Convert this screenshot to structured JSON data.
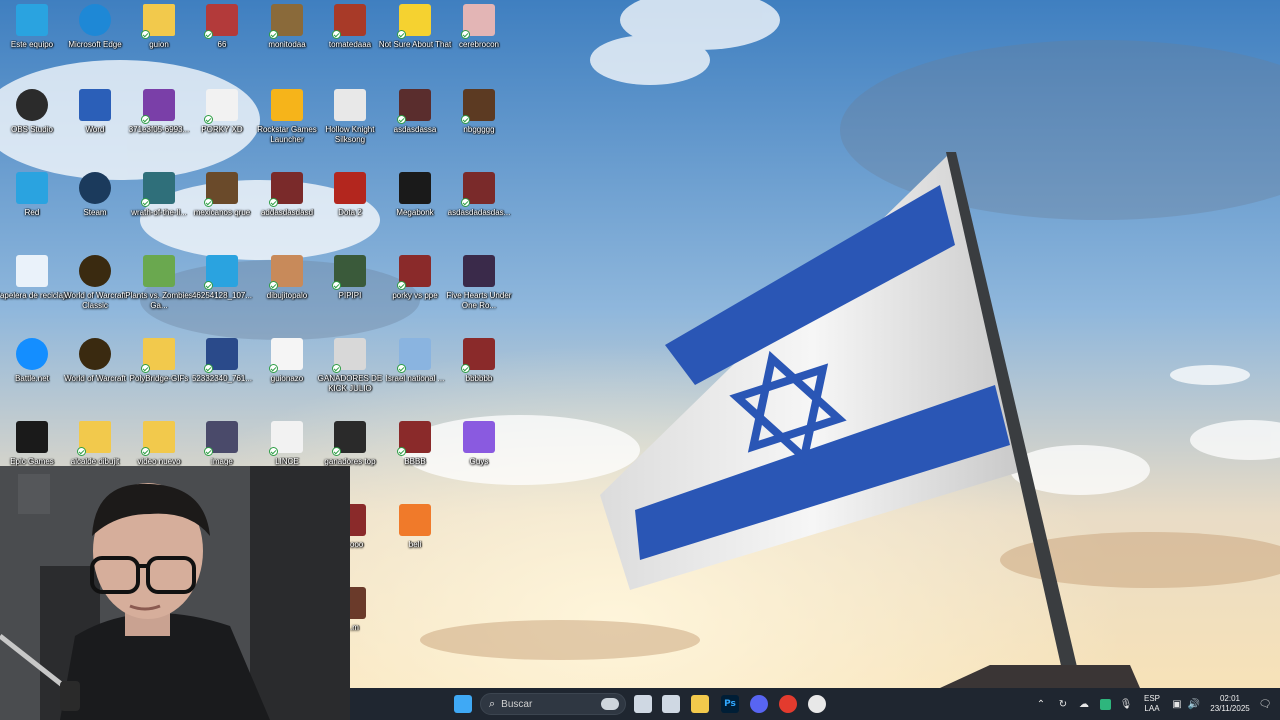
{
  "desktop": {
    "icons": [
      {
        "label": "Este equipo",
        "icon": "pc-icon",
        "color": "#2aa3e0",
        "synced": false
      },
      {
        "label": "Microsoft Edge",
        "icon": "edge-icon",
        "color": "#1e88d6",
        "synced": false
      },
      {
        "label": "guion",
        "icon": "folder-icon",
        "color": "#f2c94c",
        "synced": true
      },
      {
        "label": "66",
        "icon": "image-file-icon",
        "color": "#b33a3a",
        "synced": true
      },
      {
        "label": "monitodaa",
        "icon": "image-file-icon",
        "color": "#8a6a3a",
        "synced": true
      },
      {
        "label": "tomatedaaa",
        "icon": "image-file-icon",
        "color": "#a83a28",
        "synced": true
      },
      {
        "label": "Not Sure About That",
        "icon": "duck-image-icon",
        "color": "#f5d230",
        "synced": true
      },
      {
        "label": "cerebrocon",
        "icon": "image-file-icon",
        "color": "#e3b5b5",
        "synced": true
      },
      {
        "label": "OBS Studio",
        "icon": "obs-icon",
        "color": "#2b2b2b",
        "synced": false
      },
      {
        "label": "Word",
        "icon": "word-icon",
        "color": "#2b5fb8",
        "synced": false
      },
      {
        "label": "371e3f05-6993...",
        "icon": "qr-image-icon",
        "color": "#7a3fa8",
        "synced": true
      },
      {
        "label": "PORKY XD",
        "icon": "video-file-icon",
        "color": "#f2f2f2",
        "synced": true
      },
      {
        "label": "Rockstar Games Launcher",
        "icon": "rockstar-icon",
        "color": "#f6b41a",
        "synced": false
      },
      {
        "label": "Hollow Knight Silksong",
        "icon": "hollow-knight-icon",
        "color": "#e8e8e8",
        "synced": false
      },
      {
        "label": "asdasdassa",
        "icon": "video-thumb-icon",
        "color": "#5a2d2d",
        "synced": true
      },
      {
        "label": "nbggggg",
        "icon": "video-thumb-icon",
        "color": "#5c3a22",
        "synced": true
      },
      {
        "label": "Red",
        "icon": "network-icon",
        "color": "#2aa3e0",
        "synced": false
      },
      {
        "label": "Steam",
        "icon": "steam-icon",
        "color": "#1b3a5c",
        "synced": false
      },
      {
        "label": "wrath-of-the-li...",
        "icon": "image-file-icon",
        "color": "#2f6f7a",
        "synced": true
      },
      {
        "label": "mexicanos qrue",
        "icon": "video-thumb-icon",
        "color": "#6a4a2a",
        "synced": true
      },
      {
        "label": "addasdasdasd",
        "icon": "video-thumb-icon",
        "color": "#7a2a2a",
        "synced": true
      },
      {
        "label": "Dota 2",
        "icon": "dota-icon",
        "color": "#b3261e",
        "synced": false
      },
      {
        "label": "Megabonk",
        "icon": "megabonk-icon",
        "color": "#1a1a1a",
        "synced": false
      },
      {
        "label": "asdasdadasdas...",
        "icon": "video-thumb-icon",
        "color": "#7a2a2a",
        "synced": true
      },
      {
        "label": "Papelera de reciclaje",
        "icon": "recycle-bin-icon",
        "color": "#eaf2fa",
        "synced": false
      },
      {
        "label": "World of Warcraft Classic",
        "icon": "wow-classic-icon",
        "color": "#3a2a10",
        "synced": false
      },
      {
        "label": "Plants vs. Zombies Ga...",
        "icon": "pvz-icon",
        "color": "#6aa84f",
        "synced": false
      },
      {
        "label": "46254128_107...",
        "icon": "image-file-icon",
        "color": "#2aa3e0",
        "synced": true
      },
      {
        "label": "dibujitopalo",
        "icon": "image-file-icon",
        "color": "#c88a5a",
        "synced": true
      },
      {
        "label": "PIPIPI",
        "icon": "image-file-icon",
        "color": "#3a5a3a",
        "synced": true
      },
      {
        "label": "porky vs ppe",
        "icon": "video-thumb-icon",
        "color": "#8a2a2a",
        "synced": true
      },
      {
        "label": "Five Hearts Under One Ro...",
        "icon": "game-cover-icon",
        "color": "#3a2a4a",
        "synced": false
      },
      {
        "label": "Battle.net",
        "icon": "battlenet-icon",
        "color": "#148eff",
        "synced": false
      },
      {
        "label": "World of Warcraft",
        "icon": "wow-icon",
        "color": "#3a2a10",
        "synced": false
      },
      {
        "label": "PolyBridge-GIFs",
        "icon": "folder-icon",
        "color": "#f2c94c",
        "synced": true
      },
      {
        "label": "52332340_761...",
        "icon": "image-file-icon",
        "color": "#2a4a8a",
        "synced": true
      },
      {
        "label": "guionazo",
        "icon": "document-icon",
        "color": "#f5f5f5",
        "synced": true
      },
      {
        "label": "GANADORES DE KICK JULIO",
        "icon": "image-file-icon",
        "color": "#d8d8d8",
        "synced": true
      },
      {
        "label": "Israel national ...",
        "icon": "image-file-icon",
        "color": "#8ab4e0",
        "synced": true
      },
      {
        "label": "bbbbbb",
        "icon": "video-thumb-icon",
        "color": "#8a2a2a",
        "synced": true
      },
      {
        "label": "Epic Games Launcher",
        "icon": "epic-games-icon",
        "color": "#1a1a1a",
        "synced": false
      },
      {
        "label": "alcalde dibujit",
        "icon": "folder-icon",
        "color": "#f2c94c",
        "synced": true
      },
      {
        "label": "video nuevo",
        "icon": "folder-icon",
        "color": "#f2c94c",
        "synced": true
      },
      {
        "label": "image",
        "icon": "image-file-icon",
        "color": "#4a4a6a",
        "synced": true
      },
      {
        "label": "LINCE",
        "icon": "video-file-icon",
        "color": "#f2f2f2",
        "synced": true
      },
      {
        "label": "ganadores top",
        "icon": "image-file-icon",
        "color": "#2a2a2a",
        "synced": true
      },
      {
        "label": "BBBB",
        "icon": "video-thumb-icon",
        "color": "#8a2a2a",
        "synced": true
      },
      {
        "label": "Guys",
        "icon": "fall-guys-icon",
        "color": "#8a5ae0",
        "synced": false
      },
      {
        "label": "oooooo",
        "icon": "video-thumb-icon",
        "color": "#8a2a2a",
        "synced": true
      },
      {
        "label": "beli",
        "icon": "app-icon",
        "color": "#f07a2a",
        "synced": false
      },
      {
        "label": "_...m",
        "icon": "video-thumb-icon",
        "color": "#6a3a2a",
        "synced": true
      }
    ]
  },
  "taskbar": {
    "search_placeholder": "Buscar",
    "apps": [
      {
        "name": "start",
        "icon": "windows-start-icon",
        "color": "#3fa9f5",
        "glyph": ""
      },
      {
        "name": "task-view",
        "icon": "task-view-icon",
        "color": "#cfd8e3",
        "glyph": ""
      },
      {
        "name": "widgets",
        "icon": "chat-icon",
        "color": "#cfd8e3",
        "glyph": ""
      },
      {
        "name": "file-explorer",
        "icon": "folder-icon",
        "color": "#f2c94c",
        "glyph": ""
      },
      {
        "name": "photoshop",
        "icon": "photoshop-icon",
        "color": "#001e36",
        "glyph": "Ps"
      },
      {
        "name": "discord",
        "icon": "discord-icon",
        "color": "#5865f2",
        "glyph": ""
      },
      {
        "name": "chrome",
        "icon": "chrome-icon",
        "color": "#e33b2e",
        "glyph": ""
      },
      {
        "name": "obs",
        "icon": "obs-icon",
        "color": "#e8e8e8",
        "glyph": ""
      }
    ],
    "tray": {
      "language_line1": "ESP",
      "language_line2": "LAA",
      "time": "02:01",
      "date": "23/11/2025"
    }
  }
}
